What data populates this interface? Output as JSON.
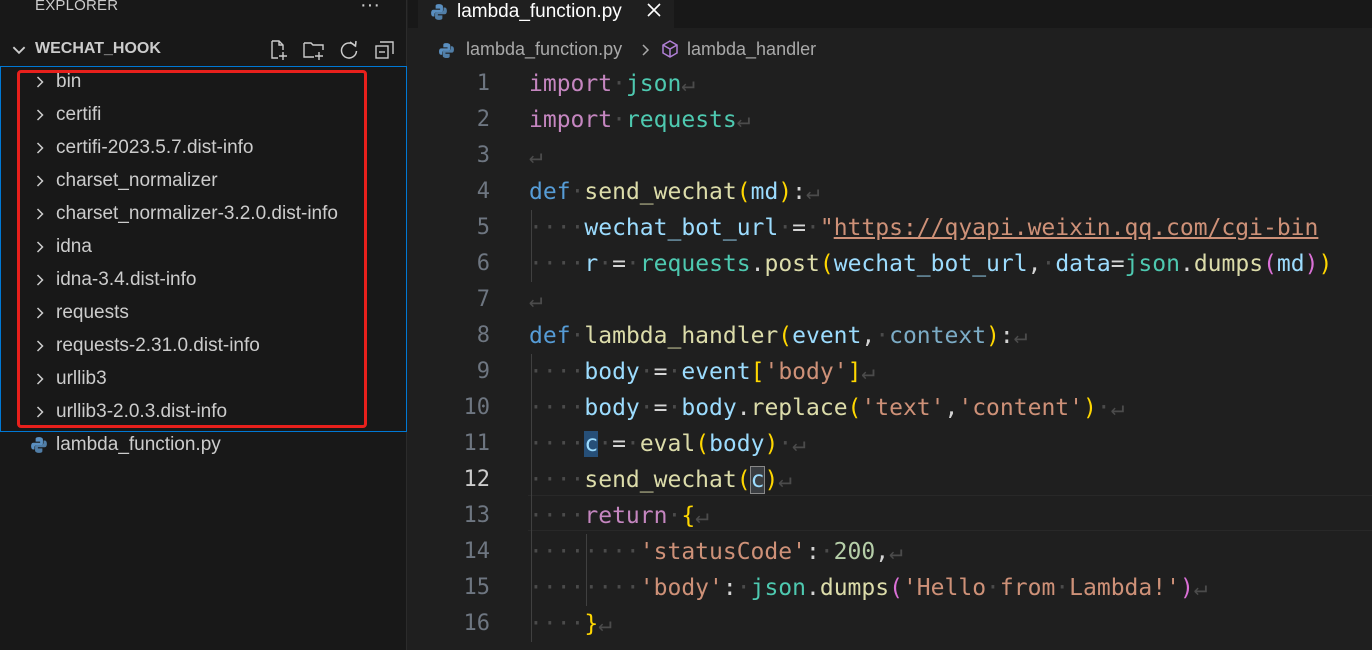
{
  "sidebar": {
    "title": "EXPLORER",
    "more_label": "···",
    "project_name": "WECHAT_HOOK",
    "tree": [
      {
        "label": "bin",
        "type": "folder"
      },
      {
        "label": "certifi",
        "type": "folder"
      },
      {
        "label": "certifi-2023.5.7.dist-info",
        "type": "folder"
      },
      {
        "label": "charset_normalizer",
        "type": "folder"
      },
      {
        "label": "charset_normalizer-3.2.0.dist-info",
        "type": "folder"
      },
      {
        "label": "idna",
        "type": "folder"
      },
      {
        "label": "idna-3.4.dist-info",
        "type": "folder"
      },
      {
        "label": "requests",
        "type": "folder"
      },
      {
        "label": "requests-2.31.0.dist-info",
        "type": "folder"
      },
      {
        "label": "urllib3",
        "type": "folder"
      },
      {
        "label": "urllib3-2.0.3.dist-info",
        "type": "folder"
      },
      {
        "label": "lambda_function.py",
        "type": "python-file"
      }
    ]
  },
  "editor": {
    "tab_label": "lambda_function.py",
    "breadcrumb": {
      "file": "lambda_function.py",
      "symbol": "lambda_handler"
    },
    "current_line": 12,
    "lines": [
      {
        "n": "1",
        "text": "import json"
      },
      {
        "n": "2",
        "text": "import requests"
      },
      {
        "n": "3",
        "text": ""
      },
      {
        "n": "4",
        "text": "def send_wechat(md):"
      },
      {
        "n": "5",
        "text": "    wechat_bot_url = \"https://qyapi.weixin.qq.com/cgi-bin"
      },
      {
        "n": "6",
        "text": "    r = requests.post(wechat_bot_url, data=json.dumps(md))"
      },
      {
        "n": "7",
        "text": ""
      },
      {
        "n": "8",
        "text": "def lambda_handler(event, context):"
      },
      {
        "n": "9",
        "text": "    body = event['body']"
      },
      {
        "n": "10",
        "text": "    body = body.replace('text','content') "
      },
      {
        "n": "11",
        "text": "    c = eval(body) "
      },
      {
        "n": "12",
        "text": "    send_wechat(c)"
      },
      {
        "n": "13",
        "text": "    return {"
      },
      {
        "n": "14",
        "text": "        'statusCode': 200,"
      },
      {
        "n": "15",
        "text": "        'body': json.dumps('Hello from Lambda!')"
      },
      {
        "n": "16",
        "text": "    }"
      }
    ]
  },
  "colors": {
    "accent": "#0078d4",
    "highlight_box": "#e8201c",
    "editor_bg": "#1f1f1f",
    "sidebar_bg": "#181818"
  },
  "icons": [
    "ellipsis-icon",
    "chevron-down-icon",
    "new-file-icon",
    "new-folder-icon",
    "refresh-icon",
    "collapse-all-icon",
    "chevron-right-icon",
    "python-file-icon",
    "close-icon",
    "symbol-method-icon"
  ]
}
